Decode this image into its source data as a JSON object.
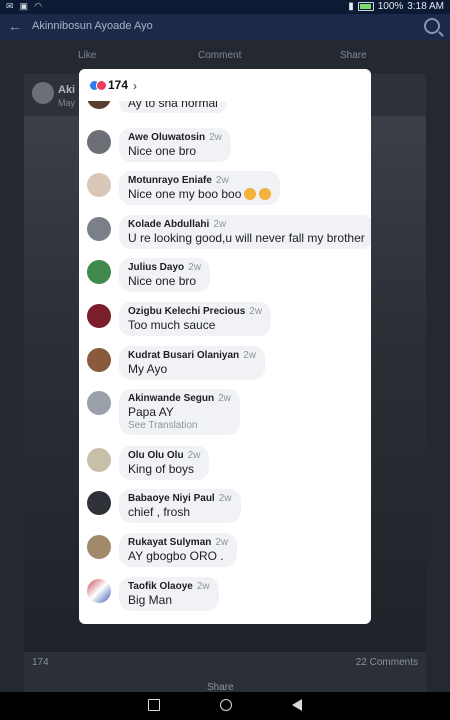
{
  "status_bar": {
    "battery": "100%",
    "time": "3:18 AM"
  },
  "app_bar": {
    "title": "Akinnibosun Ayoade Ayo"
  },
  "post_actions": {
    "like": "Like",
    "comment": "Comment",
    "share": "Share"
  },
  "post": {
    "author_short": "Aki",
    "date_short": "May",
    "reactions_count": "174",
    "comments_count": "22 Comments",
    "share": "Share"
  },
  "modal": {
    "reaction_count": "174",
    "comments": [
      {
        "name": "",
        "time": "",
        "text": "Ay to sha normal"
      },
      {
        "name": "Awe Oluwatosin",
        "time": "2w",
        "text": "Nice one bro"
      },
      {
        "name": "Motunrayo Eniafe",
        "time": "2w",
        "text": "Nice one my boo boo"
      },
      {
        "name": "Kolade Abdullahi",
        "time": "2w",
        "text": "U re looking good,u will never fall my brother"
      },
      {
        "name": "Julius Dayo",
        "time": "2w",
        "text": "Nice one bro"
      },
      {
        "name": "Ozigbu Kelechi Precious",
        "time": "2w",
        "text": "Too much sauce"
      },
      {
        "name": "Kudrat Busari Olaniyan",
        "time": "2w",
        "text": "My Ayo"
      },
      {
        "name": "Akinwande Segun",
        "time": "2w",
        "text": "Papa AY",
        "translation": "See Translation"
      },
      {
        "name": "Olu Olu Olu",
        "time": "2w",
        "text": "King of boys"
      },
      {
        "name": "Babaoye Niyi Paul",
        "time": "2w",
        "text": "chief , frosh"
      },
      {
        "name": "Rukayat Sulyman",
        "time": "2w",
        "text": "AY gbogbo ORO ."
      },
      {
        "name": "Taofik Olaoye",
        "time": "2w",
        "text": "Big Man"
      }
    ]
  },
  "colors": {
    "like": "#2d7bf0",
    "love": "#f03d5f",
    "bubble": "#f0f2f5"
  }
}
